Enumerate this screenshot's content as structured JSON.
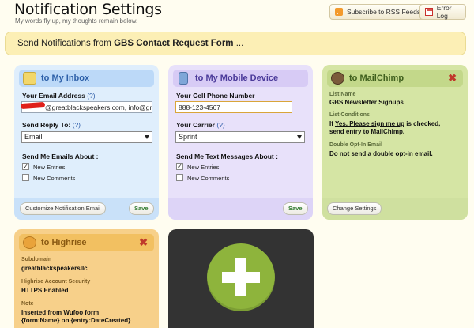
{
  "header": {
    "title": "Notification Settings",
    "subtitle": "My words fly up, my thoughts remain below.",
    "rss_button": "Subscribe to RSS Feeds",
    "error_button": "Error Log"
  },
  "banner": {
    "prefix": "Send Notifications from ",
    "form_name": "GBS Contact Request Form",
    "suffix": " ..."
  },
  "inbox": {
    "title": "to My Inbox",
    "email_label": "Your Email Address",
    "help": "(?)",
    "email_value": "@greatblackspeakers.com, info@gr",
    "reply_label": "Send Reply To:",
    "reply_value": "Email",
    "about_label": "Send Me Emails About :",
    "new_entries": "New Entries",
    "new_comments": "New Comments",
    "customize_button": "Customize Notification Email",
    "save_button": "Save"
  },
  "mobile": {
    "title": "to My Mobile Device",
    "phone_label": "Your Cell Phone Number",
    "phone_value": "888-123-4567",
    "carrier_label": "Your Carrier",
    "help": "(?)",
    "carrier_value": "Sprint",
    "about_label": "Send Me Text Messages About :",
    "new_entries": "New Entries",
    "new_comments": "New Comments",
    "save_button": "Save"
  },
  "mailchimp": {
    "title": "to MailChimp",
    "list_name_label": "List Name",
    "list_name_value": "GBS Newsletter Signups",
    "conditions_label": "List Conditions",
    "conditions_line1_prefix": "If ",
    "conditions_line1_link": "Yes, Please sign me up",
    "conditions_line1_suffix": " is checked,",
    "conditions_line2": "send entry to MailChimp.",
    "double_label": "Double Opt-In Email",
    "double_value": "Do not send a double opt-in email.",
    "change_button": "Change Settings",
    "close": "✖"
  },
  "highrise": {
    "title": "to Highrise",
    "subdomain_label": "Subdomain",
    "subdomain_value": "greatblackspeakersllc",
    "security_label": "Highrise Account Security",
    "security_value": "HTTPS Enabled",
    "note_label": "Note",
    "note_line1": "Inserted from Wufoo form",
    "note_line2": "{form:Name} on {entry:DateCreated}",
    "close": "✖"
  },
  "add_card": {
    "icon": "plus-icon"
  },
  "colors": {
    "inbox": "#bcd9f8",
    "mobile": "#d7cbf5",
    "mailchimp": "#cfe09f",
    "highrise": "#f6c978",
    "add": "#333333",
    "add_circle": "#8eb43c"
  }
}
